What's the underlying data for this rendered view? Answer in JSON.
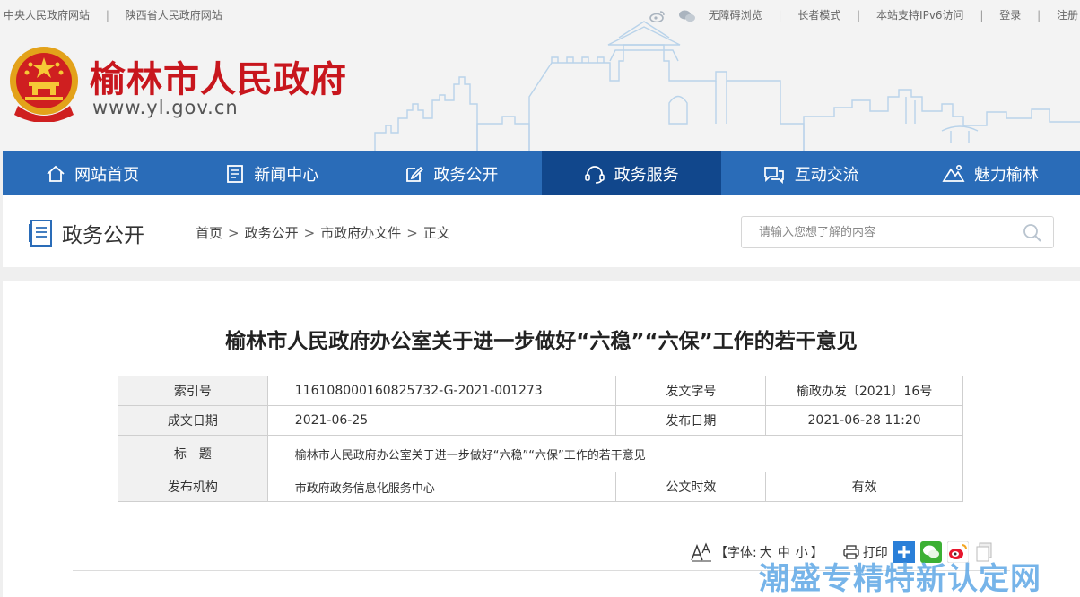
{
  "toplinks": {
    "left": [
      "中央人民政府网站",
      "陕西省人民政府网站"
    ],
    "right": [
      "无障碍浏览",
      "长者模式",
      "本站支持IPv6访问",
      "登录",
      "注册"
    ]
  },
  "site": {
    "name": "榆林市人民政府",
    "url": "www.yl.gov.cn"
  },
  "nav": [
    {
      "label": "网站首页",
      "icon": "home-icon"
    },
    {
      "label": "新闻中心",
      "icon": "news-icon"
    },
    {
      "label": "政务公开",
      "icon": "edit-icon"
    },
    {
      "label": "政务服务",
      "icon": "headset-icon"
    },
    {
      "label": "互动交流",
      "icon": "chat-icon"
    },
    {
      "label": "魅力榆林",
      "icon": "landscape-icon"
    }
  ],
  "active_nav": "政务服务",
  "section": {
    "title": "政务公开",
    "crumbs": [
      "首页",
      "政务公开",
      "市政府办文件",
      "正文"
    ]
  },
  "search": {
    "placeholder": "请输入您想了解的内容"
  },
  "article": {
    "title": "榆林市人民政府办公室关于进一步做好“六稳”“六保”工作的若干意见",
    "meta": {
      "index_label": "索引号",
      "index_value": "116108000160825732-G-2021-001273",
      "docno_label": "发文字号",
      "docno_value": "榆政办发〔2021〕16号",
      "date_label": "成文日期",
      "date_value": "2021-06-25",
      "pub_label": "发布日期",
      "pub_value": "2021-06-28 11:20",
      "title_label": "标　题",
      "title_value": "榆林市人民政府办公室关于进一步做好“六稳”“六保”工作的若干意见",
      "org_label": "发布机构",
      "org_value": "市政府政务信息化服务中心",
      "valid_label": "公文时效",
      "valid_value": "有效"
    }
  },
  "tools": {
    "font_label": "【字体:",
    "sizes": [
      "大",
      "中",
      "小"
    ],
    "close": "】",
    "print": "打印"
  },
  "watermark": "潮盛专精特新认定网",
  "colors": {
    "nav_bg": "#2a6cb8",
    "nav_active": "#11478c",
    "site_name": "#c8161d"
  }
}
